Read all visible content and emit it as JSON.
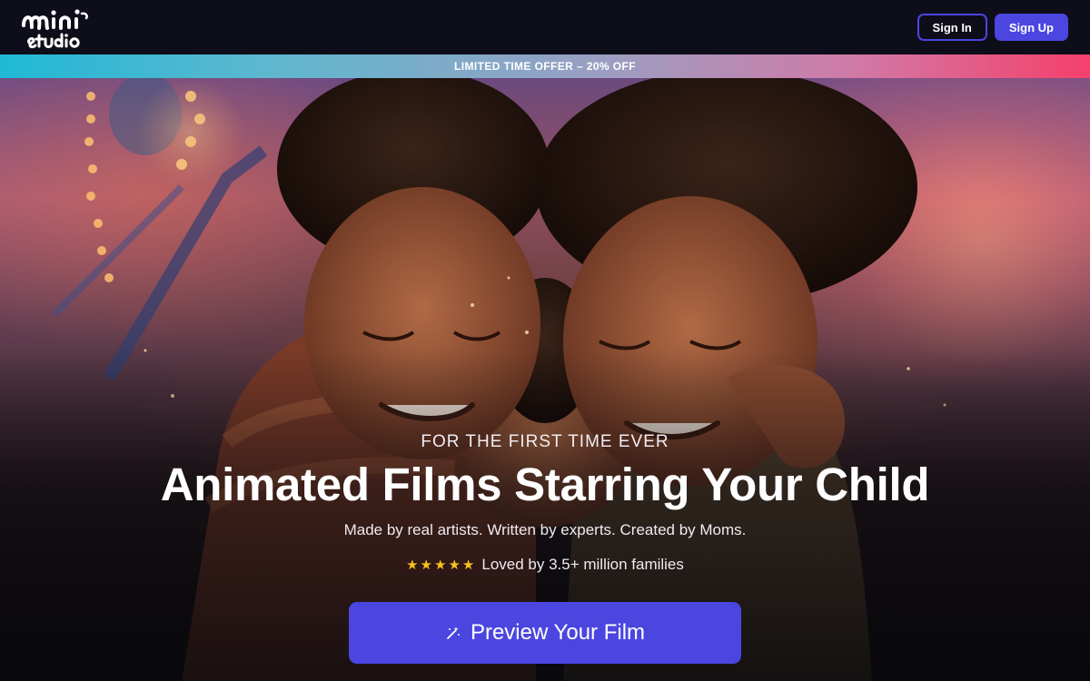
{
  "header": {
    "logo_text": "mini studio",
    "signin_label": "Sign In",
    "signup_label": "Sign Up"
  },
  "offer_bar": {
    "text": "LIMITED TIME OFFER – 20% OFF"
  },
  "hero": {
    "eyebrow": "FOR THE FIRST TIME EVER",
    "headline": "Animated Films Starring Your Child",
    "subline": "Made by real artists. Written by experts. Created by Moms.",
    "rating": {
      "stars": 5,
      "text": "Loved by 3.5+ million families"
    },
    "cta_label": "Preview Your Film",
    "cta_icon": "magic-wand-icon"
  },
  "colors": {
    "brand_accent": "#4b46e0",
    "star": "#f6c21d",
    "header_bg": "#0e0e1a",
    "offer_gradient_start": "#1fb9d6",
    "offer_gradient_end": "#f5406b"
  }
}
